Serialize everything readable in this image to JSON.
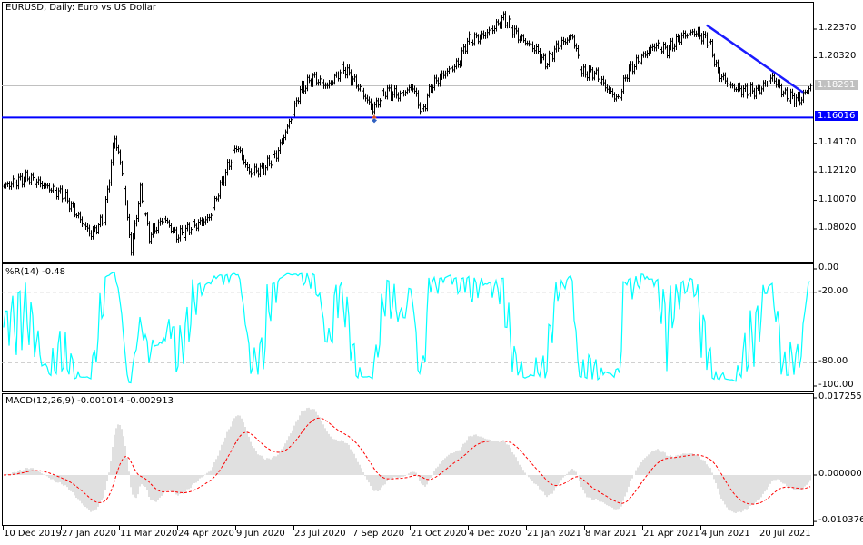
{
  "window": {
    "title": "EURUSD, Daily:  Euro vs US Dollar"
  },
  "price_axis": {
    "ticks": [
      "1.22370",
      "1.20320",
      "1.14170",
      "1.12120",
      "1.10070",
      "1.08020"
    ],
    "tick_values": [
      1.2237,
      1.2032,
      1.1417,
      1.1212,
      1.1007,
      1.0802
    ],
    "current_price": "1.18291",
    "current_value": 1.18291,
    "level_label": "1.16016",
    "level_value": 1.16016
  },
  "wpr": {
    "title": "%R(14) -0.48",
    "ticks": [
      "0.00",
      "-20.00",
      "-80.00",
      "-100.00"
    ],
    "tick_values": [
      0,
      -20,
      -80,
      -100
    ]
  },
  "macd": {
    "title": "MACD(12,26,9) -0.001014 -0.002913",
    "ticks": [
      "0.017255",
      "0.000000",
      "-0.010376"
    ],
    "tick_values": [
      0.017255,
      0,
      -0.010376
    ]
  },
  "time_axis": {
    "labels": [
      "10 Dec 2019",
      "27 Jan 2020",
      "11 Mar 2020",
      "24 Apr 2020",
      "9 Jun 2020",
      "23 Jul 2020",
      "7 Sep 2020",
      "21 Oct 2020",
      "4 Dec 2020",
      "21 Jan 2021",
      "8 Mar 2021",
      "21 Apr 2021",
      "4 Jun 2021",
      "20 Jul 2021"
    ],
    "bars_per_label": 32
  },
  "colors": {
    "candles": "#000000",
    "level_line": "#0000ff",
    "trend_line": "#1a1aff",
    "wpr": "#00ffff",
    "macd_hist": "#c0c0c0",
    "macd_signal": "#ff0000",
    "grid": "#c0c0c0"
  },
  "chart_data": {
    "type": "ohlc",
    "symbol": "EURUSD",
    "timeframe": "Daily",
    "bar_count": 445,
    "close_anchors": [
      [
        0,
        1.1108
      ],
      [
        13,
        1.1174
      ],
      [
        23,
        1.1108
      ],
      [
        33,
        1.1043
      ],
      [
        43,
        1.0848
      ],
      [
        48,
        1.0763
      ],
      [
        55,
        1.088
      ],
      [
        61,
        1.1467
      ],
      [
        65,
        1.1206
      ],
      [
        70,
        1.0652
      ],
      [
        75,
        1.1076
      ],
      [
        80,
        1.075
      ],
      [
        88,
        1.088
      ],
      [
        95,
        1.075
      ],
      [
        103,
        1.0815
      ],
      [
        113,
        1.088
      ],
      [
        120,
        1.1141
      ],
      [
        128,
        1.1402
      ],
      [
        135,
        1.1206
      ],
      [
        143,
        1.1239
      ],
      [
        150,
        1.1337
      ],
      [
        158,
        1.1598
      ],
      [
        163,
        1.1793
      ],
      [
        170,
        1.1891
      ],
      [
        178,
        1.1826
      ],
      [
        187,
        1.1957
      ],
      [
        195,
        1.1826
      ],
      [
        203,
        1.1663
      ],
      [
        210,
        1.1793
      ],
      [
        218,
        1.1761
      ],
      [
        225,
        1.1826
      ],
      [
        230,
        1.163
      ],
      [
        235,
        1.1826
      ],
      [
        243,
        1.1924
      ],
      [
        250,
        1.1989
      ],
      [
        255,
        1.2152
      ],
      [
        263,
        1.2185
      ],
      [
        270,
        1.225
      ],
      [
        275,
        1.2315
      ],
      [
        283,
        1.2185
      ],
      [
        293,
        1.2087
      ],
      [
        298,
        1.1989
      ],
      [
        305,
        1.212
      ],
      [
        313,
        1.2185
      ],
      [
        318,
        1.1924
      ],
      [
        325,
        1.1924
      ],
      [
        333,
        1.1793
      ],
      [
        338,
        1.1728
      ],
      [
        343,
        1.1924
      ],
      [
        350,
        1.2022
      ],
      [
        358,
        1.212
      ],
      [
        365,
        1.2087
      ],
      [
        373,
        1.2185
      ],
      [
        380,
        1.2217
      ],
      [
        388,
        1.2152
      ],
      [
        393,
        1.1924
      ],
      [
        400,
        1.1826
      ],
      [
        408,
        1.1793
      ],
      [
        415,
        1.1793
      ],
      [
        423,
        1.1891
      ],
      [
        430,
        1.1761
      ],
      [
        438,
        1.1728
      ],
      [
        444,
        1.1829
      ]
    ],
    "trendline": {
      "from": [
        387,
        1.2265
      ],
      "to": [
        440,
        1.1782
      ]
    },
    "arrow_bar": 204,
    "ylim": [
      1.063,
      1.242
    ]
  }
}
